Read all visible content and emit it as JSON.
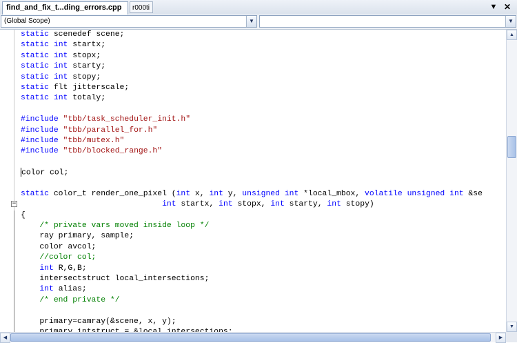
{
  "tabs": {
    "active_label": "find_and_fix_t...ding_errors.cpp",
    "inactive_label": "r000ti",
    "dropdown_glyph": "▼",
    "close_glyph": "✕"
  },
  "navbar": {
    "scope_value": "(Global Scope)",
    "members_value": "",
    "arrow_glyph": "▼"
  },
  "scrollbars": {
    "up_glyph": "▲",
    "down_glyph": "▼",
    "left_glyph": "◀",
    "right_glyph": "▶",
    "vertical_thumb_fraction": 0.4,
    "horizontal_thumb_fraction": 0.99
  },
  "colors": {
    "keyword": "#0000ff",
    "string": "#a31515",
    "comment": "#008000",
    "text": "#000000"
  },
  "code_lines": [
    [
      [
        "kw",
        "static"
      ],
      [
        "t",
        " scenedef scene;"
      ]
    ],
    [
      [
        "kw",
        "static"
      ],
      [
        "t",
        " "
      ],
      [
        "kw",
        "int"
      ],
      [
        "t",
        " startx;"
      ]
    ],
    [
      [
        "kw",
        "static"
      ],
      [
        "t",
        " "
      ],
      [
        "kw",
        "int"
      ],
      [
        "t",
        " stopx;"
      ]
    ],
    [
      [
        "kw",
        "static"
      ],
      [
        "t",
        " "
      ],
      [
        "kw",
        "int"
      ],
      [
        "t",
        " starty;"
      ]
    ],
    [
      [
        "kw",
        "static"
      ],
      [
        "t",
        " "
      ],
      [
        "kw",
        "int"
      ],
      [
        "t",
        " stopy;"
      ]
    ],
    [
      [
        "kw",
        "static"
      ],
      [
        "t",
        " flt jitterscale;"
      ]
    ],
    [
      [
        "kw",
        "static"
      ],
      [
        "t",
        " "
      ],
      [
        "kw",
        "int"
      ],
      [
        "t",
        " totaly;"
      ]
    ],
    [],
    [
      [
        "pp",
        "#include"
      ],
      [
        "t",
        " "
      ],
      [
        "str",
        "\"tbb/task_scheduler_init.h\""
      ]
    ],
    [
      [
        "pp",
        "#include"
      ],
      [
        "t",
        " "
      ],
      [
        "str",
        "\"tbb/parallel_for.h\""
      ]
    ],
    [
      [
        "pp",
        "#include"
      ],
      [
        "t",
        " "
      ],
      [
        "str",
        "\"tbb/mutex.h\""
      ]
    ],
    [
      [
        "pp",
        "#include"
      ],
      [
        "t",
        " "
      ],
      [
        "str",
        "\"tbb/blocked_range.h\""
      ]
    ],
    [],
    [
      [
        "caret",
        ""
      ],
      [
        "t",
        "color col;"
      ]
    ],
    [],
    [
      [
        "kw",
        "static"
      ],
      [
        "t",
        " color_t render_one_pixel ("
      ],
      [
        "kw",
        "int"
      ],
      [
        "t",
        " x, "
      ],
      [
        "kw",
        "int"
      ],
      [
        "t",
        " y, "
      ],
      [
        "kw",
        "unsigned"
      ],
      [
        "t",
        " "
      ],
      [
        "kw",
        "int"
      ],
      [
        "t",
        " *local_mbox, "
      ],
      [
        "kw",
        "volatile"
      ],
      [
        "t",
        " "
      ],
      [
        "kw",
        "unsigned"
      ],
      [
        "t",
        " "
      ],
      [
        "kw",
        "int"
      ],
      [
        "t",
        " &se"
      ]
    ],
    [
      [
        "t",
        "                              "
      ],
      [
        "kw",
        "int"
      ],
      [
        "t",
        " startx, "
      ],
      [
        "kw",
        "int"
      ],
      [
        "t",
        " stopx, "
      ],
      [
        "kw",
        "int"
      ],
      [
        "t",
        " starty, "
      ],
      [
        "kw",
        "int"
      ],
      [
        "t",
        " stopy)"
      ]
    ],
    [
      [
        "t",
        "{"
      ]
    ],
    [
      [
        "t",
        "    "
      ],
      [
        "cmt",
        "/* private vars moved inside loop */"
      ]
    ],
    [
      [
        "t",
        "    ray primary, sample;"
      ]
    ],
    [
      [
        "t",
        "    color avcol;"
      ]
    ],
    [
      [
        "t",
        "    "
      ],
      [
        "cmt",
        "//color col;"
      ]
    ],
    [
      [
        "t",
        "    "
      ],
      [
        "kw",
        "int"
      ],
      [
        "t",
        " R,G,B;"
      ]
    ],
    [
      [
        "t",
        "    intersectstruct local_intersections;"
      ]
    ],
    [
      [
        "t",
        "    "
      ],
      [
        "kw",
        "int"
      ],
      [
        "t",
        " alias;"
      ]
    ],
    [
      [
        "t",
        "    "
      ],
      [
        "cmt",
        "/* end private */"
      ]
    ],
    [],
    [
      [
        "t",
        "    primary=camray(&scene, x, y);"
      ]
    ],
    [
      [
        "t",
        "    primary.intstruct = &local_intersections;"
      ]
    ]
  ]
}
